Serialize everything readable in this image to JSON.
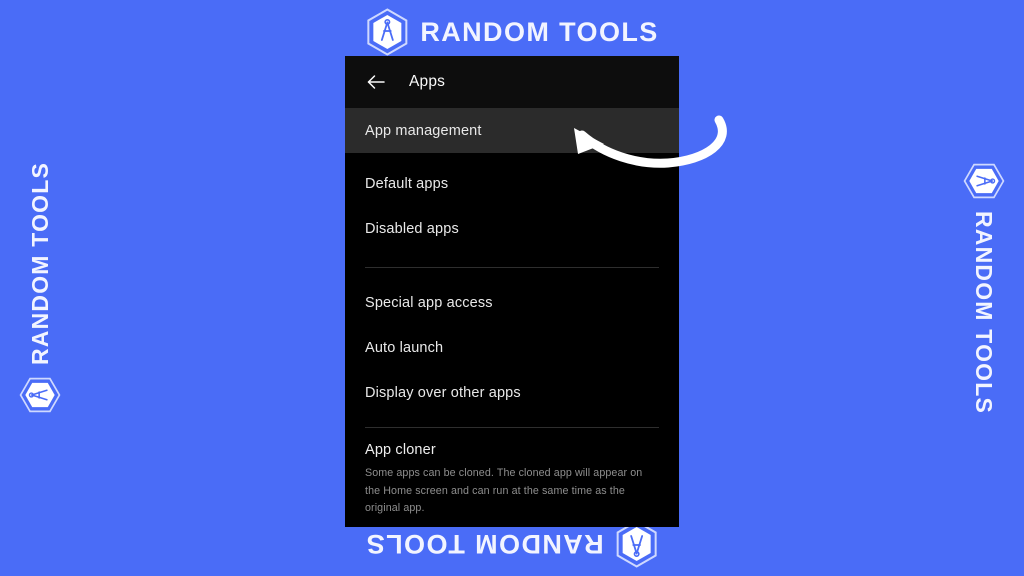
{
  "watermark": {
    "brand": "RANDOM TOOLS",
    "logo_icon": "hexagon-compass-icon",
    "accent_color": "#4a6cf7",
    "text_color": "#ffffff",
    "positions": [
      "top",
      "bottom",
      "left",
      "right"
    ]
  },
  "panel": {
    "background_color": "#000000",
    "header": {
      "back_icon": "back-arrow-icon",
      "title": "Apps"
    },
    "group_1": [
      {
        "label": "App management",
        "selected": true
      },
      {
        "label": "Default apps",
        "selected": false
      },
      {
        "label": "Disabled apps",
        "selected": false
      }
    ],
    "group_2": [
      {
        "label": "Special app access",
        "selected": false
      },
      {
        "label": "Auto launch",
        "selected": false
      },
      {
        "label": "Display over other apps",
        "selected": false
      }
    ],
    "group_3": {
      "title": "App cloner",
      "description": "Some apps can be cloned. The cloned app will appear on the Home screen and can run at the same time as the original app."
    },
    "selected_row_color": "#2b2b2b",
    "divider_color": "#2e2e2e"
  },
  "annotation": {
    "icon": "curved-arrow-icon",
    "points_to": "App management",
    "color": "#ffffff"
  }
}
